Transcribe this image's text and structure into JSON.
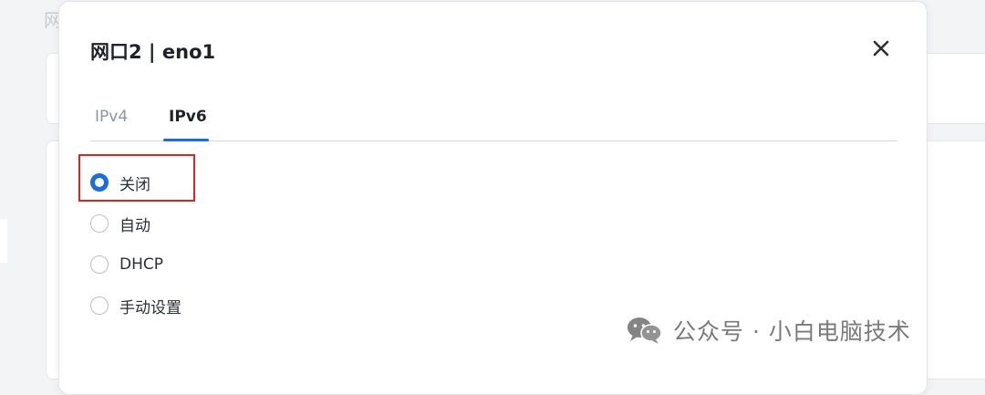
{
  "background": {
    "title_fragment": "网"
  },
  "dialog": {
    "title": "网口2 | eno1",
    "close_icon": "close-icon"
  },
  "tabs": [
    {
      "label": "IPv4",
      "active": false
    },
    {
      "label": "IPv6",
      "active": true
    }
  ],
  "ipv6_mode": {
    "options": [
      {
        "label": "关闭",
        "checked": true
      },
      {
        "label": "自动",
        "checked": false
      },
      {
        "label": "DHCP",
        "checked": false
      },
      {
        "label": "手动设置",
        "checked": false
      }
    ]
  },
  "colors": {
    "accent": "#1c6fd8",
    "highlight": "#e0231c"
  },
  "watermark": {
    "icon": "wechat-icon",
    "text": "公众号 · 小白电脑技术"
  }
}
